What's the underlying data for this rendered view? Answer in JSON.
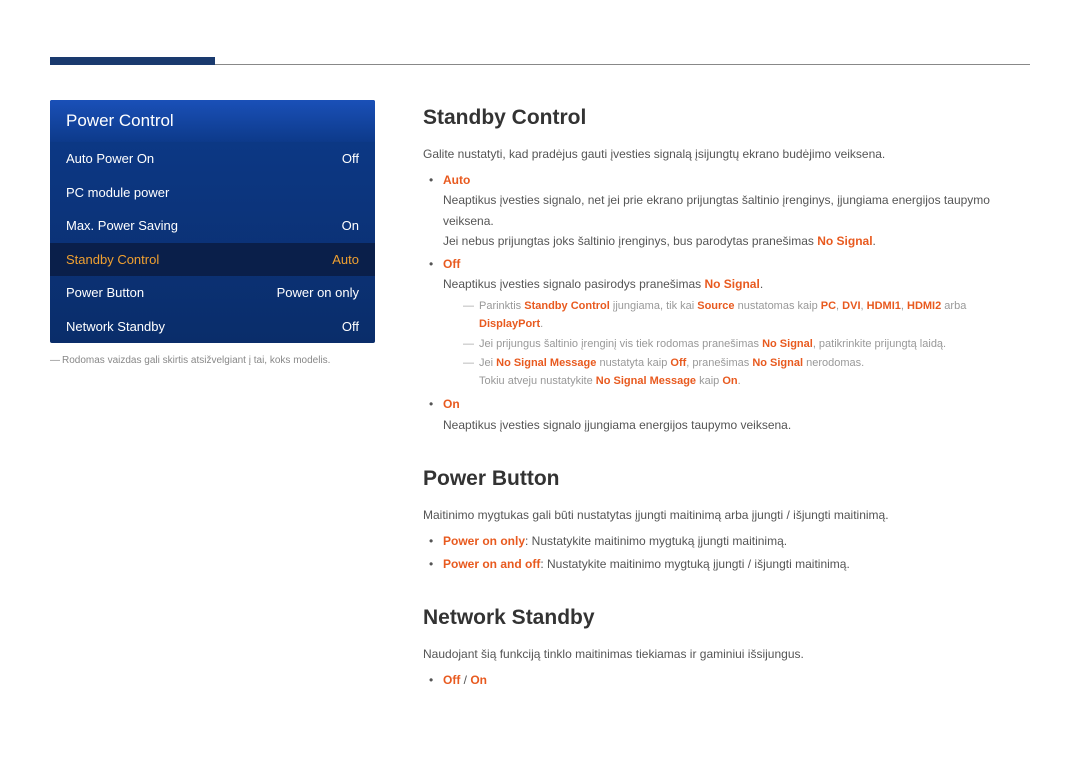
{
  "menu": {
    "title": "Power Control",
    "items": [
      {
        "label": "Auto Power On",
        "value": "Off",
        "selected": false
      },
      {
        "label": "PC module power",
        "value": "",
        "selected": false
      },
      {
        "label": "Max. Power Saving",
        "value": "On",
        "selected": false
      },
      {
        "label": "Standby Control",
        "value": "Auto",
        "selected": true
      },
      {
        "label": "Power Button",
        "value": "Power on only",
        "selected": false
      },
      {
        "label": "Network Standby",
        "value": "Off",
        "selected": false
      }
    ],
    "footnote": "Rodomas vaizdas gali skirtis atsižvelgiant į tai, koks modelis."
  },
  "sections": {
    "standby": {
      "heading": "Standby Control",
      "intro": "Galite nustatyti, kad pradėjus gauti įvesties signalą įsijungtų ekrano budėjimo veiksena.",
      "auto_label": "Auto",
      "auto_line1": "Neaptikus įvesties signalo, net jei prie ekrano prijungtas šaltinio įrenginys, įjungiama energijos taupymo veiksena.",
      "auto_line2_a": "Jei nebus prijungtas joks šaltinio įrenginys, bus parodytas pranešimas ",
      "auto_line2_b": "No Signal",
      "auto_line2_c": ".",
      "off_label": "Off",
      "off_line1_a": "Neaptikus įvesties signalo pasirodys pranešimas ",
      "off_line1_b": "No Signal",
      "off_line1_c": ".",
      "note1_a": "Parinktis ",
      "note1_b": "Standby Control",
      "note1_c": " įjungiama, tik kai ",
      "note1_d": "Source",
      "note1_e": " nustatomas kaip ",
      "note1_f": "PC",
      "note1_g": ", ",
      "note1_h": "DVI",
      "note1_i": ", ",
      "note1_j": "HDMI1",
      "note1_k": ", ",
      "note1_l": "HDMI2",
      "note1_m": " arba ",
      "note1_n": "DisplayPort",
      "note1_o": ".",
      "note2_a": "Jei prijungus šaltinio įrenginį vis tiek rodomas pranešimas ",
      "note2_b": "No Signal",
      "note2_c": ", patikrinkite prijungtą laidą.",
      "note3_a": "Jei ",
      "note3_b": "No Signal Message",
      "note3_c": " nustatyta kaip ",
      "note3_d": "Off",
      "note3_e": ", pranešimas ",
      "note3_f": "No Signal",
      "note3_g": " nerodomas.",
      "note3_line2_a": "Tokiu atveju nustatykite ",
      "note3_line2_b": "No Signal Message",
      "note3_line2_c": " kaip ",
      "note3_line2_d": "On",
      "note3_line2_e": ".",
      "on_label": "On",
      "on_line1": "Neaptikus įvesties signalo įjungiama energijos taupymo veiksena."
    },
    "powerbutton": {
      "heading": "Power Button",
      "intro": "Maitinimo mygtukas gali būti nustatytas įjungti maitinimą arba įjungti / išjungti maitinimą.",
      "opt1_a": "Power on only",
      "opt1_b": ": Nustatykite maitinimo mygtuką įjungti maitinimą.",
      "opt2_a": "Power on and off",
      "opt2_b": ": Nustatykite maitinimo mygtuką įjungti / išjungti maitinimą."
    },
    "networkstandby": {
      "heading": "Network Standby",
      "intro": "Naudojant šią funkciją tinklo maitinimas tiekiamas ir gaminiui išsijungus.",
      "opt_a": "Off",
      "opt_sep": " / ",
      "opt_b": "On"
    }
  }
}
